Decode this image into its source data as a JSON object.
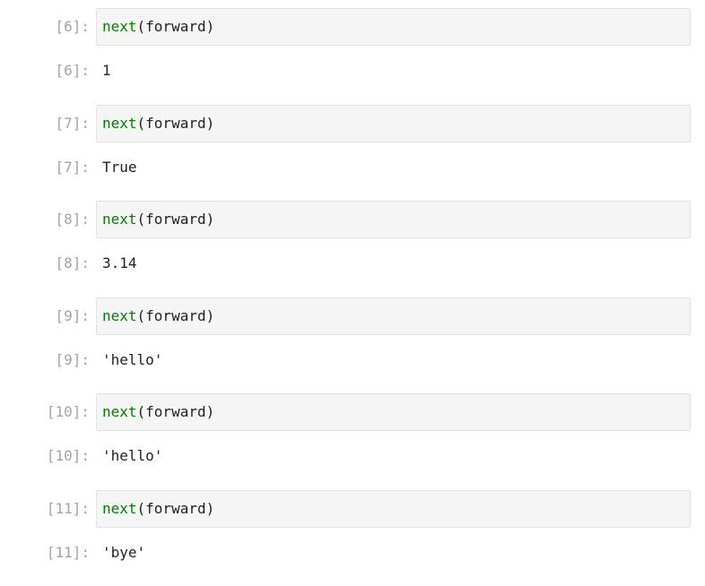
{
  "cells": [
    {
      "input_prompt": "[6]:",
      "code": {
        "func": "next",
        "rest": "(forward)"
      },
      "output_prompt": "[6]:",
      "output": "1"
    },
    {
      "input_prompt": "[7]:",
      "code": {
        "func": "next",
        "rest": "(forward)"
      },
      "output_prompt": "[7]:",
      "output": "True"
    },
    {
      "input_prompt": "[8]:",
      "code": {
        "func": "next",
        "rest": "(forward)"
      },
      "output_prompt": "[8]:",
      "output": "3.14"
    },
    {
      "input_prompt": "[9]:",
      "code": {
        "func": "next",
        "rest": "(forward)"
      },
      "output_prompt": "[9]:",
      "output": "'hello'"
    },
    {
      "input_prompt": "[10]:",
      "code": {
        "func": "next",
        "rest": "(forward)"
      },
      "output_prompt": "[10]:",
      "output": "'hello'"
    },
    {
      "input_prompt": "[11]:",
      "code": {
        "func": "next",
        "rest": "(forward)"
      },
      "output_prompt": "[11]:",
      "output": "'bye'"
    }
  ],
  "colors": {
    "builtin": "#008000",
    "prompt": "#a3a3a3",
    "editor_bg": "#f5f5f5",
    "editor_border": "#e0e0e0"
  }
}
